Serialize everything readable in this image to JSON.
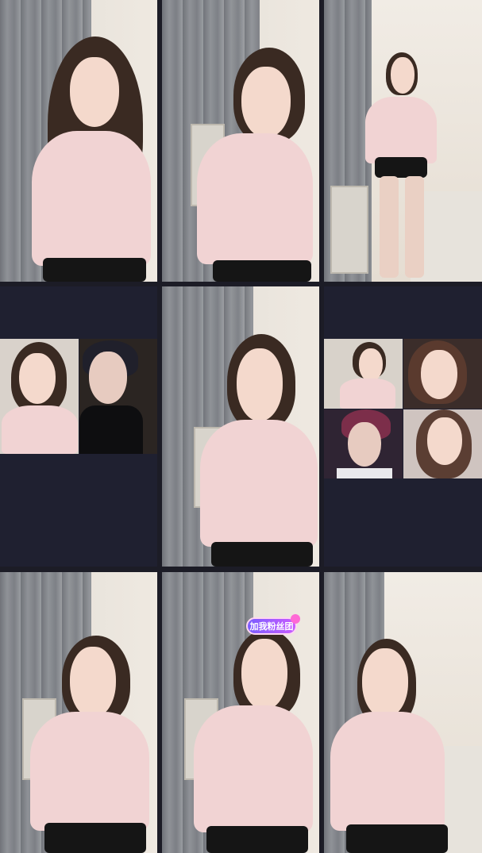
{
  "live": {
    "badge_label": "加我粉丝团"
  },
  "colors": {
    "background": "#1c1c26",
    "divider": "#0f0f16",
    "badge_gradient_start": "#7a5cff",
    "badge_gradient_end": "#c95bff"
  },
  "icons": {
    "badge_icon": "fan-club-badge-icon"
  }
}
